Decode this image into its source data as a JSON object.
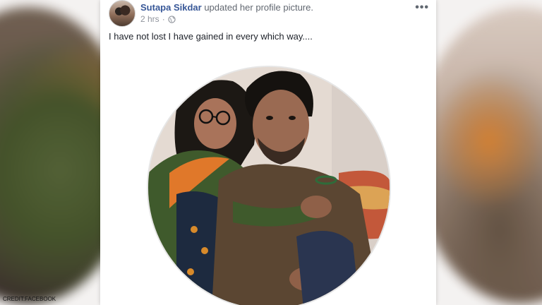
{
  "post": {
    "author": "Sutapa Sikdar",
    "action": "updated her profile picture.",
    "time": "2 hrs",
    "time_separator": "·",
    "privacy_icon": "globe-icon",
    "menu_label": "•••",
    "text": "I have not lost I have gained in every which way....",
    "photo": "profile photo of a woman and a man sitting together"
  },
  "credit": "CREDIT:FACEBOOK",
  "colors": {
    "author_link": "#385898",
    "secondary_text": "#616770",
    "body_text": "#1d2129",
    "meta_text": "#90949c"
  }
}
